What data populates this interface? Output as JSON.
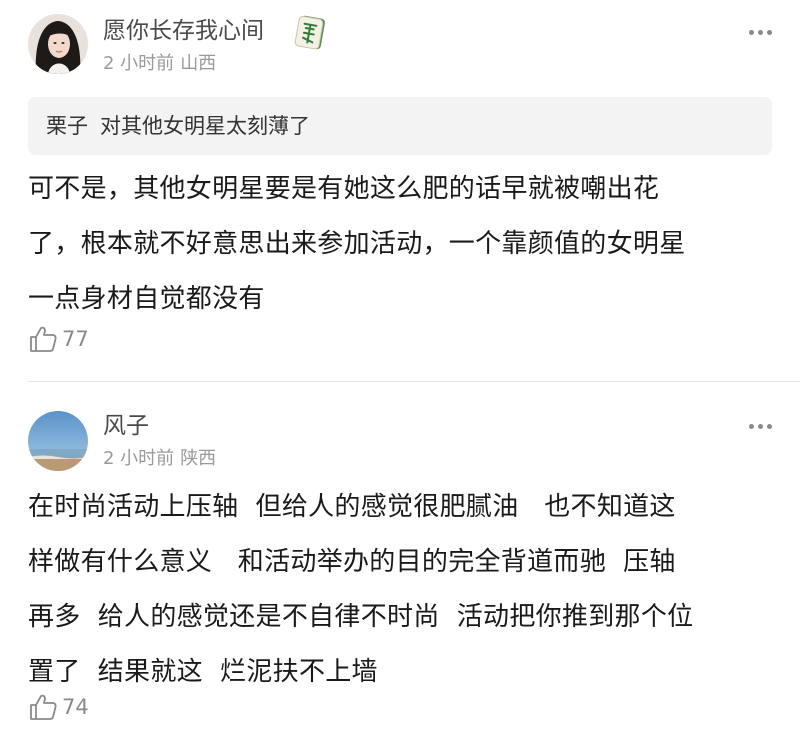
{
  "comments": [
    {
      "user": "愿你长存我心间",
      "time": "2 小时前",
      "location": "山西",
      "badge_icon": "mahjong-fa-tile-icon",
      "quote": {
        "user": "栗子",
        "text": "对其他女明星太刻薄了"
      },
      "lines": [
        "可不是，其他女明星要是有她这么肥的话早就被嘲出花",
        "了，根本就不好意思出来参加活动，一个靠颜值的女明星",
        "一点身材自觉都没有"
      ],
      "likes": "77"
    },
    {
      "user": "风子",
      "time": "2 小时前",
      "location": "陕西",
      "lines": [
        "在时尚活动上压轴  但给人的感觉很肥腻油   也不知道这",
        "样做有什么意义   和活动举办的目的完全背道而驰  压轴",
        "再多  给人的感觉还是不自律不时尚  活动把你推到那个位",
        "置了  结果就这  烂泥扶不上墙"
      ],
      "likes": "74"
    }
  ]
}
